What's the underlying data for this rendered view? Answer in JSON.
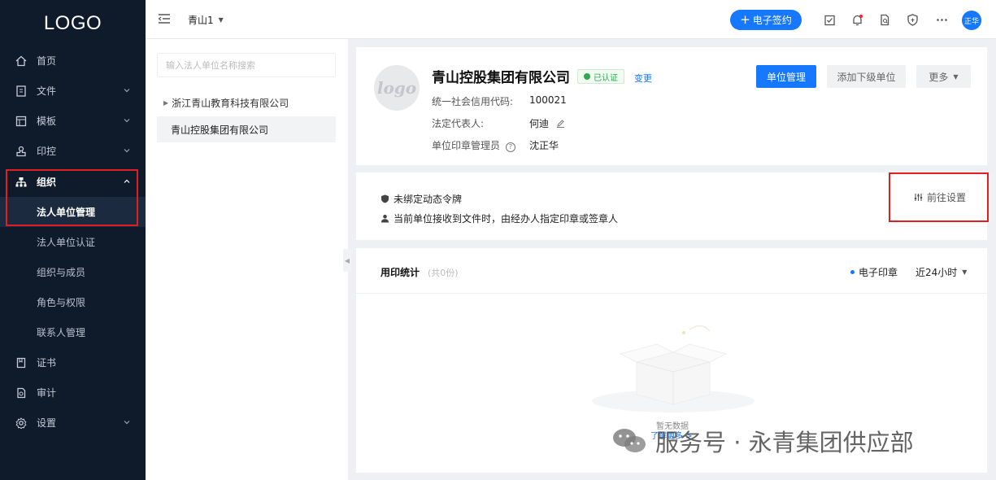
{
  "sidebar": {
    "logo": "LOGO",
    "items": [
      {
        "label": "首页",
        "icon": "home-icon"
      },
      {
        "label": "文件",
        "icon": "file-icon"
      },
      {
        "label": "模板",
        "icon": "template-icon"
      },
      {
        "label": "印控",
        "icon": "stamp-icon"
      },
      {
        "label": "组织",
        "icon": "org-icon"
      },
      {
        "label": "证书",
        "icon": "certificate-icon"
      },
      {
        "label": "审计",
        "icon": "audit-icon"
      },
      {
        "label": "设置",
        "icon": "gear-icon"
      }
    ],
    "org_sub": [
      "法人单位管理",
      "法人单位认证",
      "组织与成员",
      "角色与权限",
      "联系人管理"
    ]
  },
  "topbar": {
    "workspace": "青山1",
    "esign_label": "电子签约",
    "avatar_text": "正华"
  },
  "left_pane": {
    "search_placeholder": "输入法人单位名称搜索",
    "tree": [
      "浙江青山教育科技有限公司",
      "青山控股集团有限公司"
    ]
  },
  "company": {
    "logo_text": "logo",
    "name": "青山控股集团有限公司",
    "verified": "已认证",
    "change": "变更",
    "credit_code_label": "统一社会信用代码:",
    "credit_code": "100021",
    "legal_rep_label": "法定代表人:",
    "legal_rep": "何迪",
    "seal_admin_label": "单位印章管理员",
    "seal_admin": "沈正华",
    "btn_manage": "单位管理",
    "btn_add_sub": "添加下级单位",
    "btn_more": "更多"
  },
  "token_card": {
    "line1": "未绑定动态令牌",
    "line2": "当前单位接收到文件时，由经办人指定印章或签章人",
    "goto": "前往设置"
  },
  "stats": {
    "title": "用印统计",
    "count": "(共0份)",
    "legend": "电子印章",
    "range": "近24小时",
    "empty": "暂无数据",
    "learn": "了解更多 >"
  },
  "watermark": "服务号 · 永青集团供应部",
  "colors": {
    "primary": "#1677ff",
    "sidebar": "#0f1a2b",
    "highlight_box": "#e02020",
    "verified": "#2fa84f"
  }
}
